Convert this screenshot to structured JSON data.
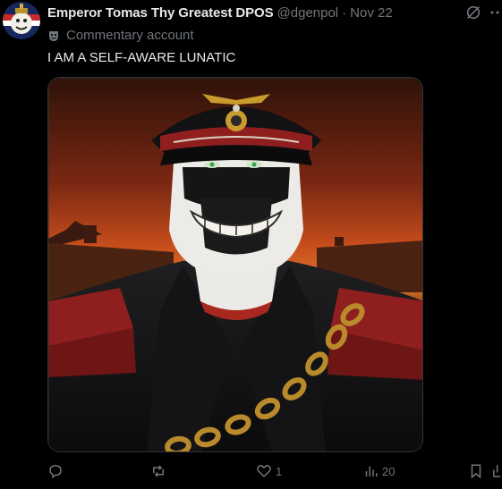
{
  "post": {
    "display_name": "Emperor Tomas Thy Greatest DPOS",
    "handle": "@dgenpol",
    "separator": "·",
    "date": "Nov 22",
    "label": "Commentary account",
    "text": "I AM A SELF-AWARE LUNATIC"
  },
  "actions": {
    "reply_count": "",
    "repost_count": "",
    "like_count": "1",
    "views_count": "20"
  },
  "icons": {
    "avatar": "avatar-image",
    "label_icon": "theater-mask-icon",
    "grok": "grok-icon",
    "more": "more-icon",
    "reply": "reply-icon",
    "repost": "repost-icon",
    "like": "heart-icon",
    "views": "views-icon",
    "bookmark": "bookmark-icon",
    "share": "share-icon"
  },
  "colors": {
    "background": "#000000",
    "text_primary": "#e7e9ea",
    "text_secondary": "#71767b",
    "sky_orange": "#d35a1f",
    "sky_dark": "#3a140c"
  }
}
